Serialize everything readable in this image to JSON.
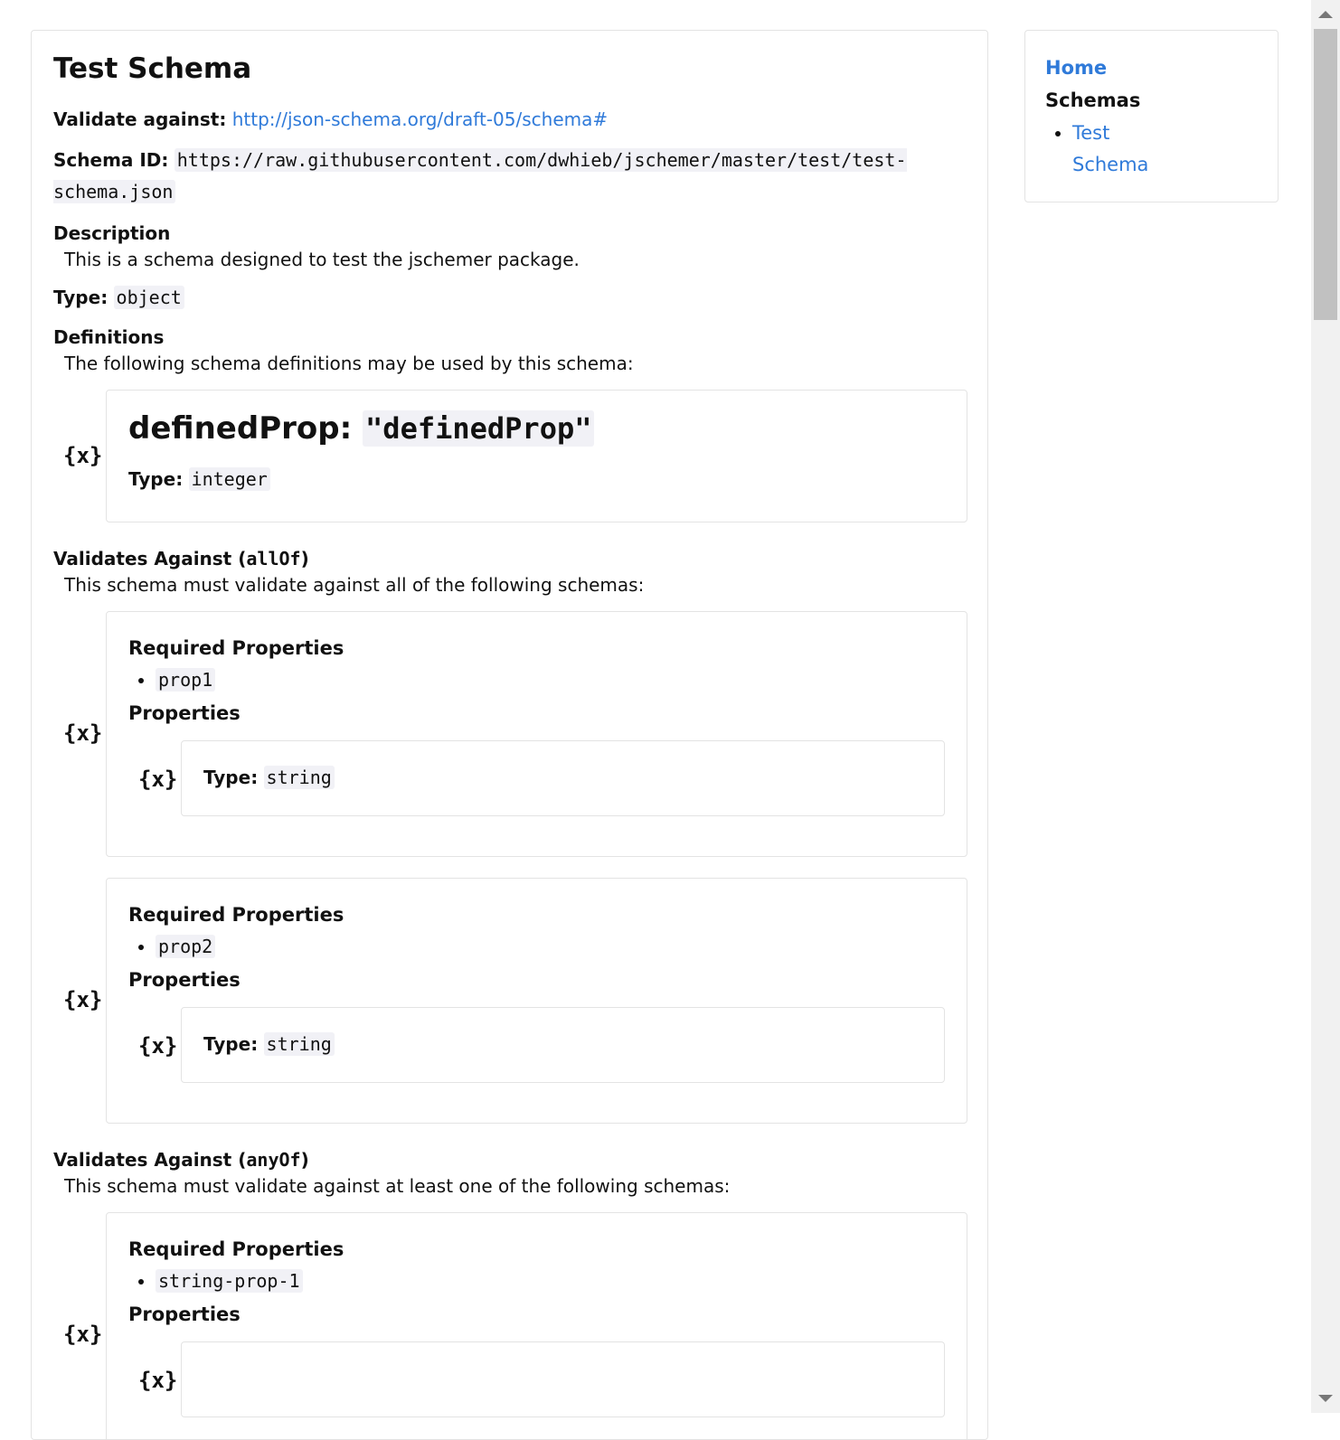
{
  "page": {
    "title": "Test Schema",
    "validate_label": "Validate against:",
    "validate_link": "http://json-schema.org/draft-05/schema#",
    "schema_id_label": "Schema ID:",
    "schema_id_value": "https://raw.githubusercontent.com/dwhieb/jschemer/master/test/test-schema.json",
    "description_heading": "Description",
    "description_text": "This is a schema designed to test the jschemer package.",
    "type_label": "Type:",
    "type_value": "object",
    "definitions_heading": "Definitions",
    "definitions_text": "The following schema definitions may be used by this schema:"
  },
  "definition": {
    "name": "definedProp:",
    "key": "\"definedProp\"",
    "type_label": "Type:",
    "type_value": "integer"
  },
  "allof": {
    "heading_prefix": "Validates Against (",
    "keyword": "allOf",
    "heading_suffix": ")",
    "text": "This schema must validate against all of the following schemas:",
    "schemas": [
      {
        "required_heading": "Required Properties",
        "required": [
          "prop1"
        ],
        "properties_heading": "Properties",
        "prop_type_label": "Type:",
        "prop_type_value": "string"
      },
      {
        "required_heading": "Required Properties",
        "required": [
          "prop2"
        ],
        "properties_heading": "Properties",
        "prop_type_label": "Type:",
        "prop_type_value": "string"
      }
    ]
  },
  "anyof": {
    "heading_prefix": "Validates Against (",
    "keyword": "anyOf",
    "heading_suffix": ")",
    "text": "This schema must validate against at least one of the following schemas:",
    "schemas": [
      {
        "required_heading": "Required Properties",
        "required": [
          "string-prop-1"
        ],
        "properties_heading": "Properties"
      }
    ]
  },
  "sidebar": {
    "home": "Home",
    "schemas_heading": "Schemas",
    "items": [
      "Test Schema"
    ]
  },
  "icons": {
    "schema_icon": "schema-braces-icon",
    "glyph": "{x}"
  }
}
